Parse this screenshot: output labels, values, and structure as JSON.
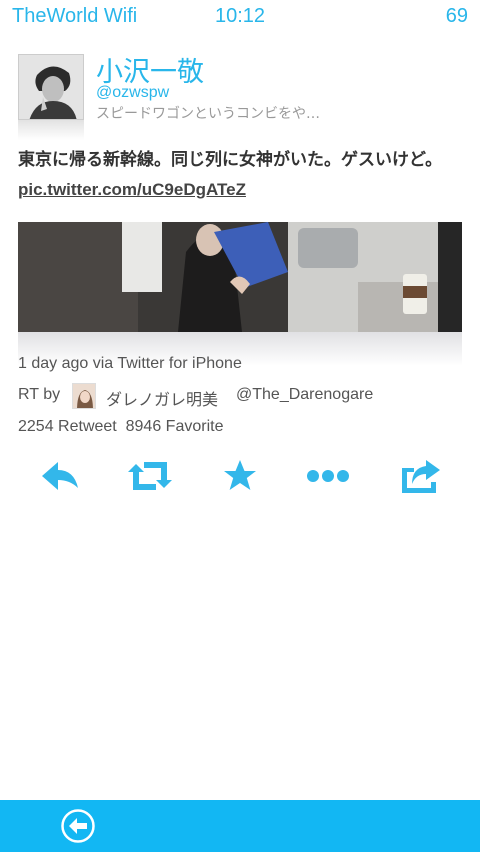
{
  "status": {
    "carrier": "TheWorld Wifi",
    "time": "10:12",
    "battery": "69"
  },
  "user": {
    "display_name": "小沢一敬",
    "screen_name": "@ozwspw",
    "bio": "スピードワゴンというコンビをや…"
  },
  "tweet": {
    "text": "東京に帰る新幹線。同じ列に女神がいた。ゲスいけど。",
    "link": "pic.twitter.com/uC9eDgATeZ",
    "time_ago": "1 day ago",
    "via": "via Twitter for iPhone"
  },
  "retweet": {
    "label": "RT by",
    "name": "ダレノガレ明美",
    "screen_name": "@The_Darenogare"
  },
  "counts": {
    "retweet": "2254 Retweet",
    "favorite": "8946 Favorite"
  },
  "actions": [
    "reply-icon",
    "retweet-icon",
    "star-icon",
    "more-icon",
    "share-icon"
  ],
  "colors": {
    "accent": "#29b6ea",
    "bar": "#12b7f3"
  }
}
